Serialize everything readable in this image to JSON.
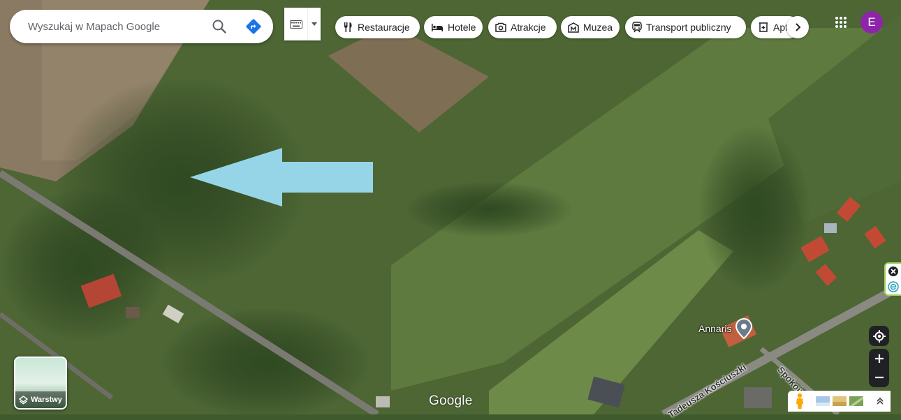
{
  "search": {
    "placeholder": "Wyszukaj w Mapach Google",
    "search_icon": "search-icon",
    "directions_icon": "directions-icon"
  },
  "keyboard": {
    "icon": "keyboard-icon",
    "dropdown_icon": "caret-down-icon"
  },
  "categories": [
    {
      "label": "Restauracje",
      "icon": "restaurant-icon"
    },
    {
      "label": "Hotele",
      "icon": "hotel-icon"
    },
    {
      "label": "Atrakcje",
      "icon": "camera-icon"
    },
    {
      "label": "Muzea",
      "icon": "museum-icon"
    },
    {
      "label": "Transport publiczny",
      "icon": "transit-icon"
    },
    {
      "label": "Apteki",
      "icon": "pharmacy-icon"
    }
  ],
  "account": {
    "initial": "E",
    "color": "#8e24aa"
  },
  "map": {
    "place_label": "Annaris",
    "streets": [
      "Tadeusza Kościuszki",
      "Spokojna"
    ],
    "google_logo": "Google",
    "arrow_color": "#96d5e8"
  },
  "layers": {
    "label": "Warstwy"
  },
  "controls": {
    "zoom_in": "+",
    "zoom_out": "−"
  }
}
